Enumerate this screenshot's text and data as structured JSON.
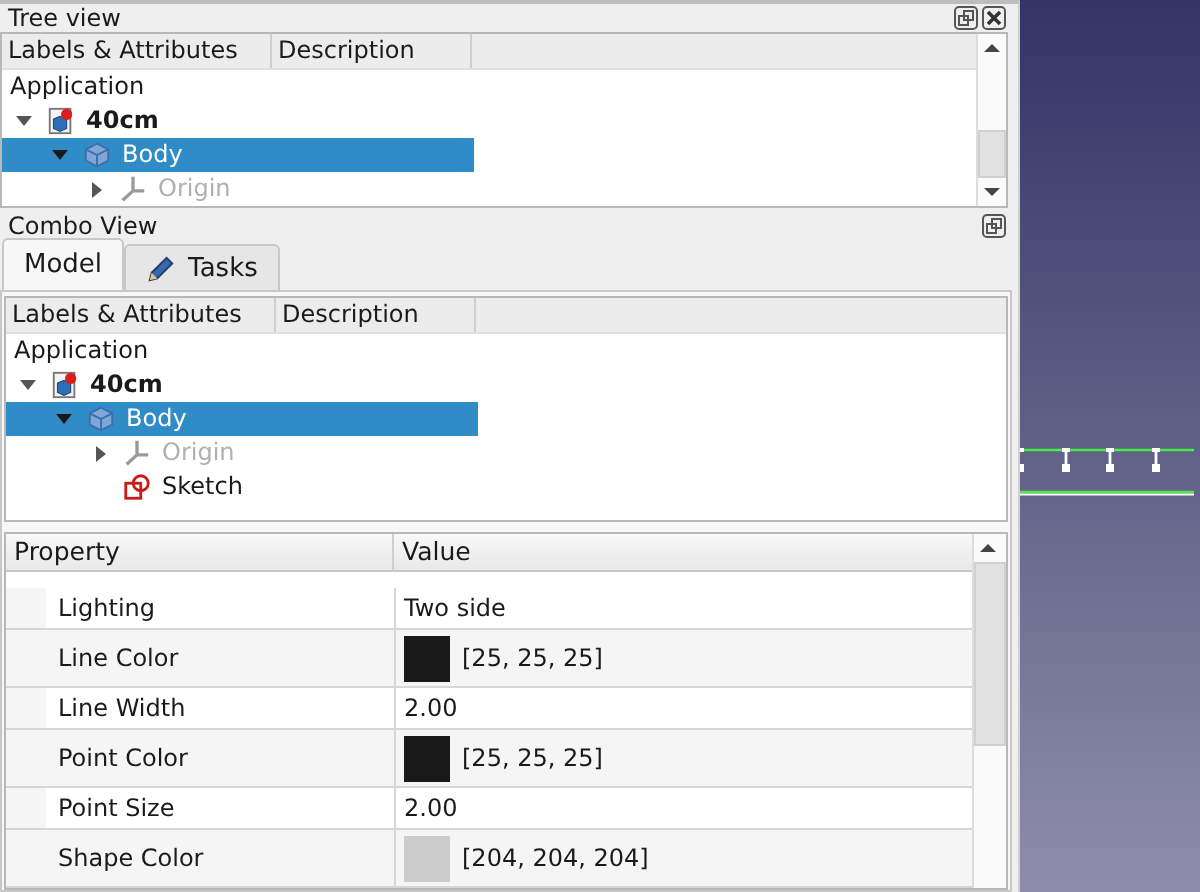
{
  "tree_view": {
    "title": "Tree view",
    "columns": [
      "Labels & Attributes",
      "Description"
    ],
    "root_label": "Application",
    "items": [
      {
        "label": "40cm",
        "kind": "document",
        "bold": true,
        "selected": false,
        "disabled": false,
        "expanded": true,
        "children": [
          {
            "label": "Body",
            "kind": "body",
            "bold": false,
            "selected": true,
            "disabled": false,
            "expanded": true,
            "children": [
              {
                "label": "Origin",
                "kind": "origin",
                "bold": false,
                "selected": false,
                "disabled": true,
                "expanded": false
              }
            ]
          }
        ]
      }
    ]
  },
  "combo_view": {
    "title": "Combo View",
    "tabs": [
      {
        "label": "Model",
        "kind": "plain",
        "selected": true
      },
      {
        "label": "Tasks",
        "kind": "pencil",
        "selected": false
      }
    ],
    "tree": {
      "columns": [
        "Labels & Attributes",
        "Description"
      ],
      "root_label": "Application",
      "items": [
        {
          "label": "40cm",
          "kind": "document",
          "bold": true,
          "selected": false,
          "disabled": false,
          "expanded": true,
          "children": [
            {
              "label": "Body",
              "kind": "body",
              "bold": false,
              "selected": true,
              "disabled": false,
              "expanded": true,
              "children": [
                {
                  "label": "Origin",
                  "kind": "origin",
                  "bold": false,
                  "selected": false,
                  "disabled": true,
                  "expanded": false
                },
                {
                  "label": "Sketch",
                  "kind": "sketch",
                  "bold": false,
                  "selected": false,
                  "disabled": false
                }
              ]
            }
          ]
        }
      ]
    },
    "properties": {
      "columns": [
        "Property",
        "Value"
      ],
      "rows": [
        {
          "name": "Lighting",
          "kind": "text",
          "value": "Two side"
        },
        {
          "name": "Line Color",
          "kind": "color",
          "value": "[25, 25, 25]",
          "color": "#191919"
        },
        {
          "name": "Line Width",
          "kind": "text",
          "value": "2.00"
        },
        {
          "name": "Point Color",
          "kind": "color",
          "value": "[25, 25, 25]",
          "color": "#191919"
        },
        {
          "name": "Point Size",
          "kind": "text",
          "value": "2.00"
        },
        {
          "name": "Shape Color",
          "kind": "color",
          "value": "[204, 204, 204]",
          "color": "#cccccc"
        }
      ]
    }
  }
}
